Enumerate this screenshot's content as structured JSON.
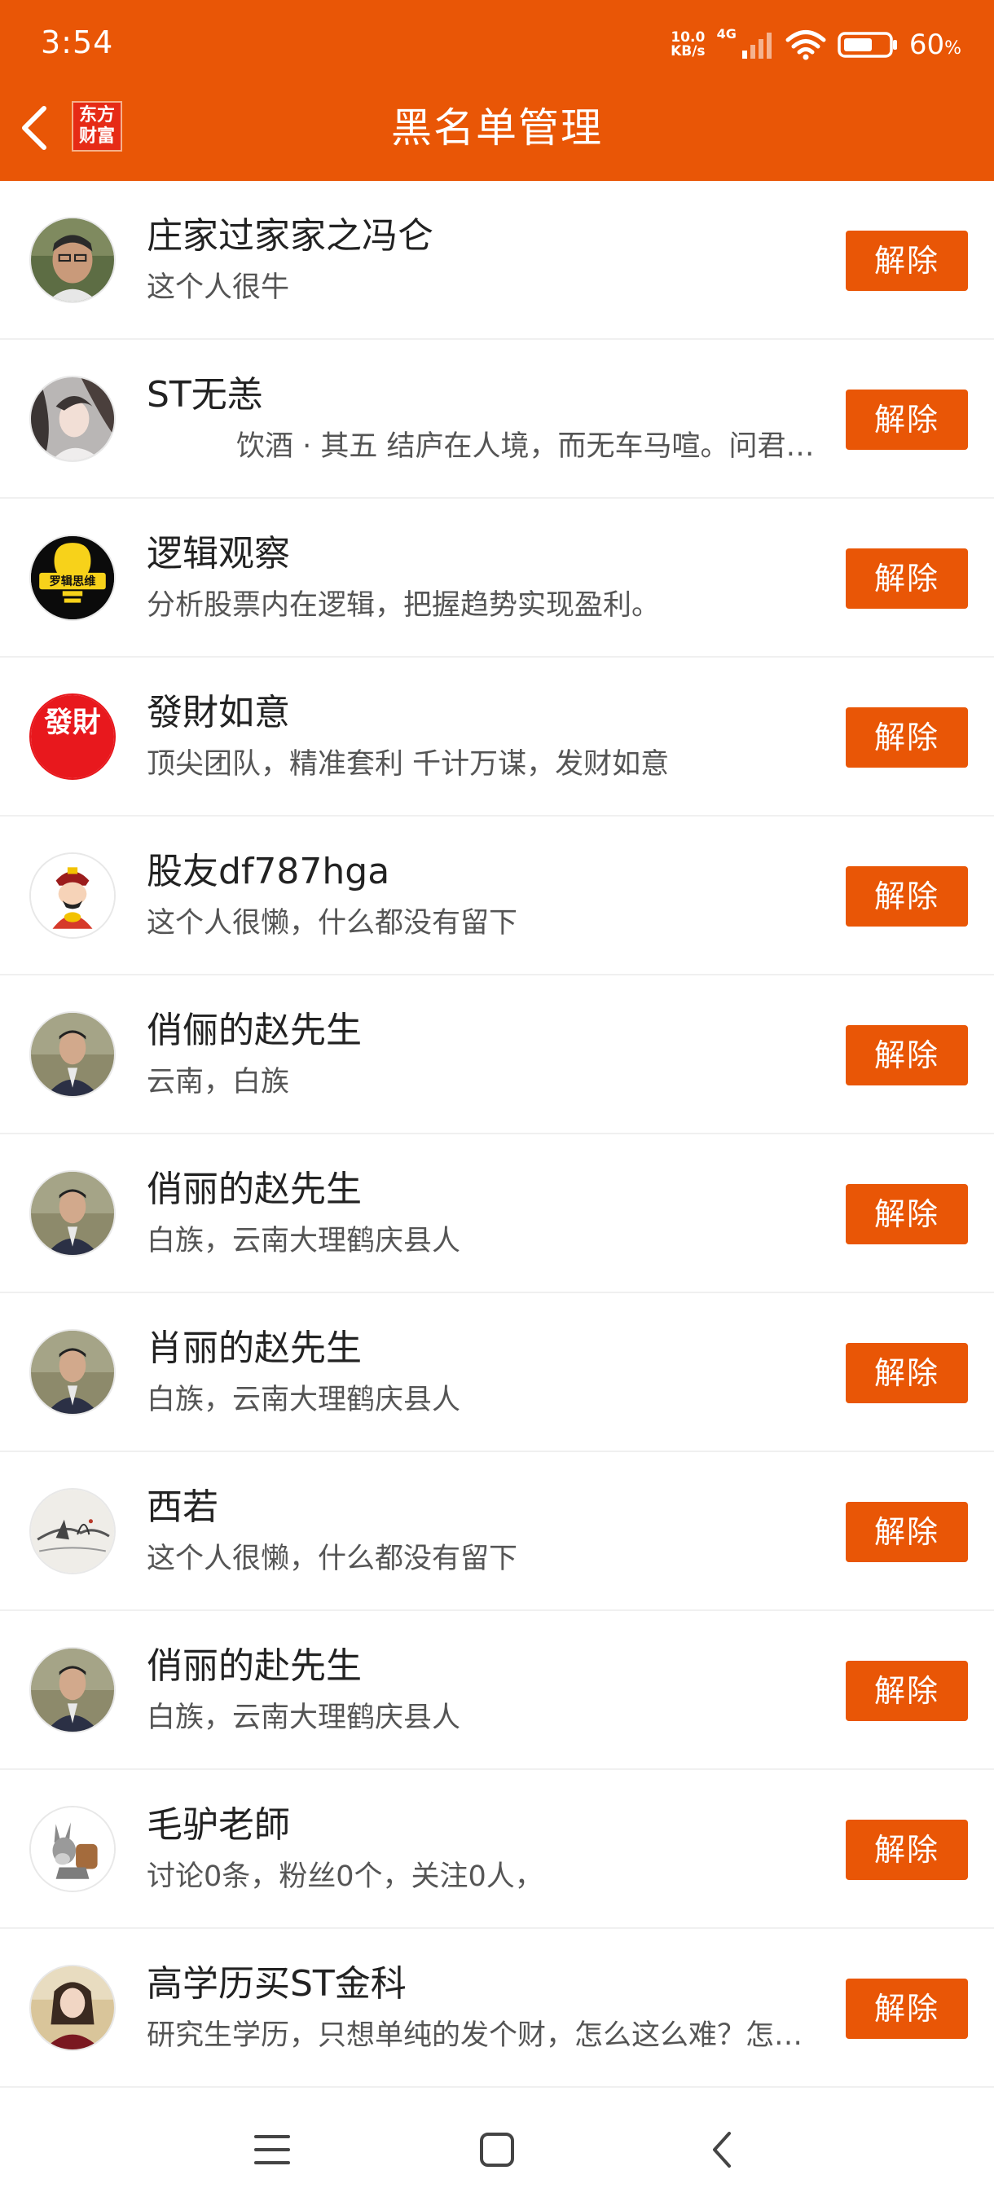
{
  "status_bar": {
    "time": "3:54",
    "net_speed_value": "10.0",
    "net_speed_unit": "KB/s",
    "network_type": "4G",
    "battery": "60",
    "battery_unit": "%"
  },
  "header": {
    "brand_line1": "东方",
    "brand_line2": "财富",
    "title": "黑名单管理"
  },
  "colors": {
    "accent": "#e95606"
  },
  "users": [
    {
      "name": "庄家过家家之冯仑",
      "bio": "这个人很牛",
      "button": "解除",
      "avatar_icon": "person-photo-avatar"
    },
    {
      "name": "ST无恙",
      "bio": "饮酒 · 其五 结庐在人境，而无车马喧。问君何能尔？心远地自偏。",
      "button": "解除",
      "avatar_icon": "anime-character-avatar"
    },
    {
      "name": "逻辑观察",
      "bio": "分析股票内在逻辑，把握趋势实现盈利。",
      "button": "解除",
      "avatar_icon": "logic-thinking-bulb-avatar",
      "avatar_text": "罗辑思维"
    },
    {
      "name": "發財如意",
      "bio": "顶尖团队，精准套利 千计万谋，发财如意",
      "button": "解除",
      "avatar_icon": "facai-calligraphy-avatar",
      "avatar_text": "發財"
    },
    {
      "name": "股友df787hga",
      "bio": "这个人很懒，什么都没有留下",
      "button": "解除",
      "avatar_icon": "fortune-god-avatar"
    },
    {
      "name": "俏俪的赵先生",
      "bio": "云南，白族",
      "button": "解除",
      "avatar_icon": "man-in-suit-avatar"
    },
    {
      "name": "俏丽的赵先生",
      "bio": "白族，云南大理鹤庆县人",
      "button": "解除",
      "avatar_icon": "man-in-suit-avatar"
    },
    {
      "name": "肖丽的赵先生",
      "bio": "白族，云南大理鹤庆县人",
      "button": "解除",
      "avatar_icon": "man-in-suit-avatar"
    },
    {
      "name": "西若",
      "bio": "这个人很懒，什么都没有留下",
      "button": "解除",
      "avatar_icon": "ink-painting-avatar"
    },
    {
      "name": "俏丽的赴先生",
      "bio": "白族，云南大理鹤庆县人",
      "button": "解除",
      "avatar_icon": "man-in-suit-avatar"
    },
    {
      "name": "毛驴老師",
      "bio": "讨论0条，粉丝0个，关注0人，",
      "button": "解除",
      "avatar_icon": "donkey-cartoon-avatar"
    },
    {
      "name": "高学历买ST金科",
      "bio": "研究生学历，只想单纯的发个财，怎么这么难？怎么这么难？",
      "button": "解除",
      "avatar_icon": "woman-photo-avatar"
    }
  ]
}
